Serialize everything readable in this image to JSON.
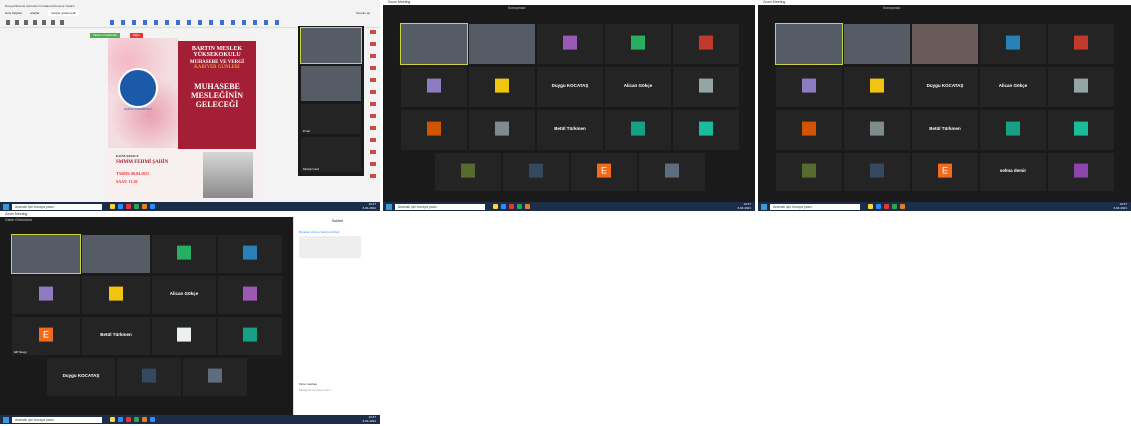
{
  "pdf_window": {
    "menu": "Dosya  Düzenle  Görünüm  İmzalama  Pencere  Yardım",
    "tabs": [
      "Giriş Sayfası",
      "Araçlar",
      "kariyer günleri.pdf"
    ],
    "signin": "Oturum aç",
    "toolbar_chip1": "Tasarım hakkında",
    "toolbar_chip2": "Diğer",
    "poster": {
      "title1": "BARTIN MESLEK",
      "title2": "YÜKSEKOKULU",
      "title3": "MUHASEBE VE VERGİ",
      "title4": "KARİYER GÜNLERİ",
      "sub1": "MUHASEBE",
      "sub2": "MESLEĞİNİN",
      "sub3": "GELECEĞİ",
      "speaker_label": "KONUŞMACI:",
      "speaker_name": "SMMM FEHMİ ŞAHİN",
      "date": "TARİH: 06.04.2021",
      "time": "SAAT: 13.30",
      "logo_text": "BARTIN ÜNİVERSİTESİ"
    },
    "side_names": [
      "",
      "",
      "",
      "Pınar",
      "Muhammed"
    ]
  },
  "zoom_windows": {
    "title": "Zoom Meeting",
    "view_label": "Galeri Görünümü",
    "speaker_banner": "Konuşmacı",
    "chat_header": "Sohbet",
    "chat_to": "Kime: Herkes",
    "chat_placeholder": "Mesajınızı buraya yazın...",
    "chat_msg_from": "Buradan Ahmet Sefa'ya (Özel)",
    "names": {
      "duygu": "Duygu KOCATAŞ",
      "alican": "Alican Gökçe",
      "betul": "Betül Türkmen",
      "selma": "selma demir",
      "e_initial": "E",
      "e_name": "Elif Sevgi"
    }
  },
  "taskbar": {
    "search": "Aramak için buraya yazın",
    "time": "13:47",
    "date": "6.04.2021"
  }
}
